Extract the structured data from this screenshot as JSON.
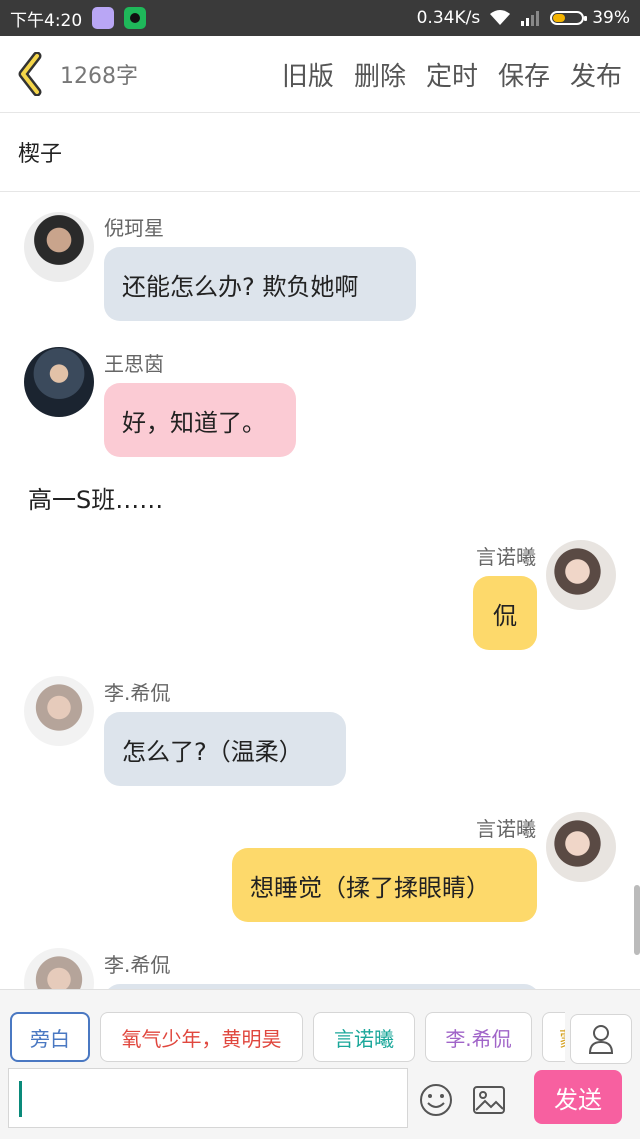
{
  "status_bar": {
    "time": "下午4:20",
    "speed": "0.34K/s",
    "battery": "39%",
    "battery_level": 0.39
  },
  "header": {
    "word_count": "1268字",
    "actions": [
      "旧版",
      "删除",
      "定时",
      "保存",
      "发布"
    ]
  },
  "title": "楔子",
  "messages": [
    {
      "side": "left",
      "name": "倪珂星",
      "text": "还能怎么办? 欺负她啊",
      "bubble": "gray"
    },
    {
      "side": "left",
      "name": "王思茵",
      "text": "好，知道了。",
      "bubble": "pink"
    },
    {
      "side": "narration",
      "text": "高一S班……"
    },
    {
      "side": "right",
      "name": "言诺曦",
      "text": "侃",
      "bubble": "yellow"
    },
    {
      "side": "left",
      "name": "李.希侃",
      "text": "怎么了?（温柔）",
      "bubble": "gray"
    },
    {
      "side": "right",
      "name": "言诺曦",
      "text": "想睡觉（揉了揉眼睛）",
      "bubble": "yellow"
    },
    {
      "side": "left",
      "name": "李.希侃",
      "text": "",
      "bubble": "gray"
    }
  ],
  "roles": [
    {
      "label": "旁白",
      "color": "#4a78c2",
      "selected": true
    },
    {
      "label": "氧气少年，黄明昊",
      "color": "#e0473e"
    },
    {
      "label": "言诺曦",
      "color": "#1ba79a"
    },
    {
      "label": "李.希侃",
      "color": "#a064c8"
    },
    {
      "label": "蒙",
      "color": "#d4a020"
    }
  ],
  "composer": {
    "value": "",
    "send_label": "发送"
  }
}
